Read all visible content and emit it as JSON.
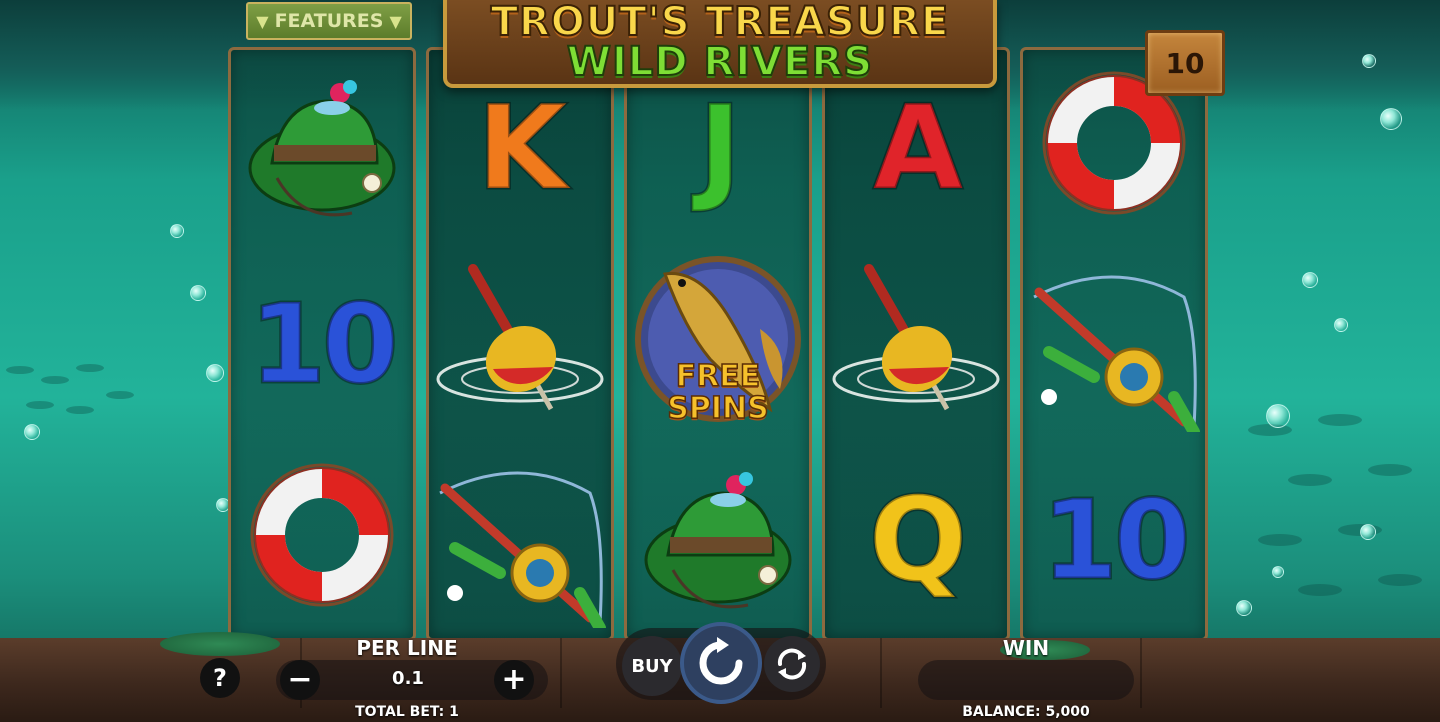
{
  "game": {
    "title_line1": "TROUT'S TREASURE",
    "title_line2": "WILD RIVERS",
    "features_label": "FEATURES",
    "counter": "10"
  },
  "reels": [
    [
      "fishing-hat",
      "10",
      "lifebuoy"
    ],
    [
      "K",
      "bobber",
      "fishing-rod"
    ],
    [
      "J",
      "free-spins-scatter",
      "fishing-hat"
    ],
    [
      "A",
      "bobber",
      "Q"
    ],
    [
      "lifebuoy",
      "fishing-rod",
      "10"
    ]
  ],
  "scatter": {
    "line1": "FREE",
    "line2": "SPINS"
  },
  "controls": {
    "help_label": "?",
    "per_line_label": "PER LINE",
    "per_line_value": "0.1",
    "minus_label": "−",
    "plus_label": "+",
    "total_bet": "TOTAL BET: 1",
    "buy_label": "BUY",
    "win_label": "WIN",
    "win_value": "",
    "balance": "BALANCE: 5,000"
  },
  "colors": {
    "letter_K": "#f07a1c",
    "letter_J": "#3cc12d",
    "letter_A": "#e0242a",
    "letter_Q": "#f1c31a",
    "number_10": "#2a52d8"
  }
}
